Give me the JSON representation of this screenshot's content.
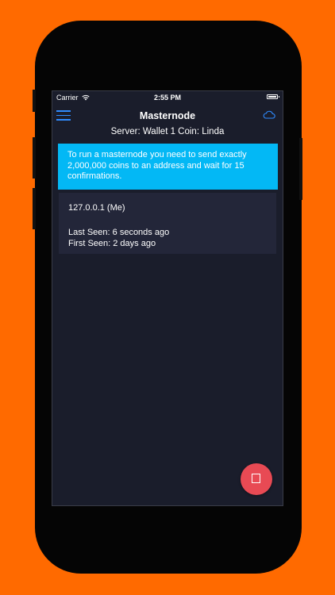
{
  "status_bar": {
    "carrier": "Carrier",
    "time": "2:55 PM",
    "wifi_icon": "wifi-icon",
    "battery_icon": "battery-icon"
  },
  "nav": {
    "title": "Masternode",
    "menu_icon": "hamburger-menu-icon",
    "cloud_icon": "cloud-icon"
  },
  "server_line": "Server: Wallet 1 Coin: Linda",
  "info_banner": "To run a masternode you need to send exactly 2,000,000 coins to an address and wait for 15 confirmations.",
  "nodes": [
    {
      "ip": "127.0.0.1 (Me)",
      "last_seen": "Last Seen: 6 seconds ago",
      "first_seen": "First Seen: 2 days ago"
    }
  ],
  "fab": {
    "icon": "stop-icon"
  },
  "colors": {
    "background": "#ff6a00",
    "screen": "#1a1d2b",
    "accent": "#2f8bff",
    "banner": "#03b8f5",
    "card": "#232639",
    "fab": "#e84a54"
  }
}
